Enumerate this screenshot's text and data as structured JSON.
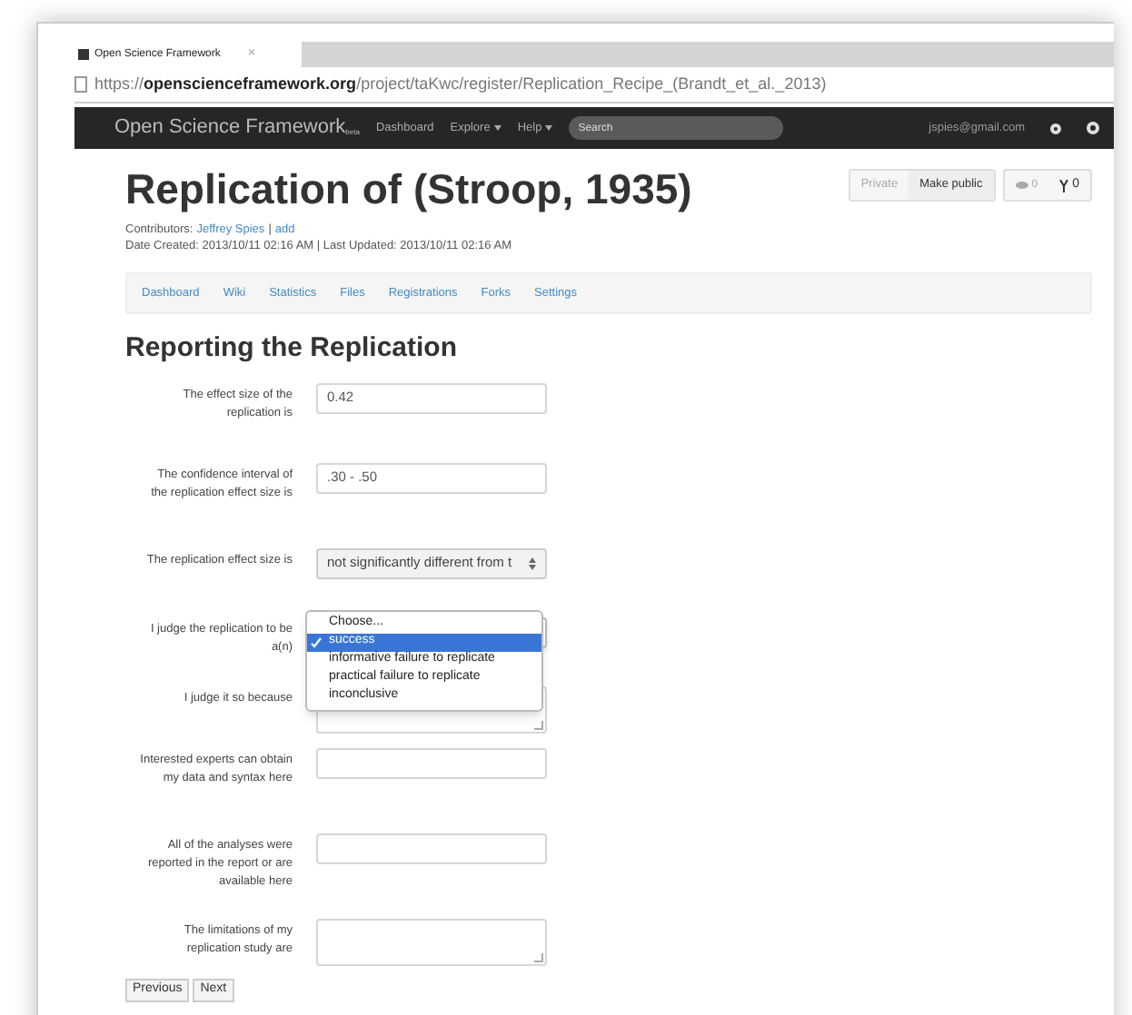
{
  "browser": {
    "tab_title": "Open Science Framework",
    "tab_close": "×",
    "url_host": "openscienceframework.org",
    "url_scheme": "https://",
    "url_path": "/project/taKwc/register/Replication_Recipe_(Brandt_et_al._2013)"
  },
  "navbar": {
    "brand": "Open Science Framework",
    "brand_badge": "beta",
    "links": [
      {
        "label": "Dashboard",
        "dropdown": false
      },
      {
        "label": "Explore",
        "dropdown": true
      },
      {
        "label": "Help",
        "dropdown": true
      }
    ],
    "search": {
      "placeholder": "Search"
    },
    "user": "jspies@gmail.com"
  },
  "project": {
    "title": "Replication of (Stroop, 1935)",
    "contributors_label": "Contributors:",
    "contributors": [
      "Jeffrey Spies"
    ],
    "separator": "|",
    "add_link": "add",
    "dates": "Date Created: 2013/10/11 02:16 AM | Last Updated: 2013/10/11 02:16 AM",
    "buttons": [
      {
        "label": "Private",
        "selected": true
      },
      {
        "label": "Make public",
        "selected": false
      }
    ],
    "watch_count": "0",
    "fork_count": "0"
  },
  "tabs": [
    {
      "label": "Dashboard"
    },
    {
      "label": "Wiki"
    },
    {
      "label": "Statistics"
    },
    {
      "label": "Files"
    },
    {
      "label": "Registrations"
    },
    {
      "label": "Forks"
    },
    {
      "label": "Settings"
    }
  ],
  "section_title": "Reporting the Replication",
  "fields": [
    {
      "kind": "input",
      "label": "The effect size of the replication is",
      "value": "0.42"
    },
    {
      "kind": "input",
      "label": "The confidence interval of the replication effect size is",
      "value": ".30 - .50"
    },
    {
      "kind": "select",
      "label": "The replication effect size is",
      "value": "not significantly different from t",
      "expanded": false
    },
    {
      "kind": "select",
      "label": "I judge the replication to be a(n)",
      "expanded": true,
      "options": [
        {
          "label": "Choose...",
          "selected": false
        },
        {
          "label": "success",
          "selected": true
        },
        {
          "label": "informative failure to replicate",
          "selected": false
        },
        {
          "label": "practical failure to replicate",
          "selected": false
        },
        {
          "label": "inconclusive",
          "selected": false
        }
      ]
    },
    {
      "kind": "textarea",
      "label": "I judge it so because"
    },
    {
      "kind": "input",
      "label": "Interested experts can obtain my data and syntax here"
    },
    {
      "kind": "input",
      "label": "All of the analyses were reported in the report or are available here"
    },
    {
      "kind": "textarea",
      "label": "The limitations of my replication study are"
    }
  ],
  "buttons": [
    "Previous",
    "Next"
  ]
}
